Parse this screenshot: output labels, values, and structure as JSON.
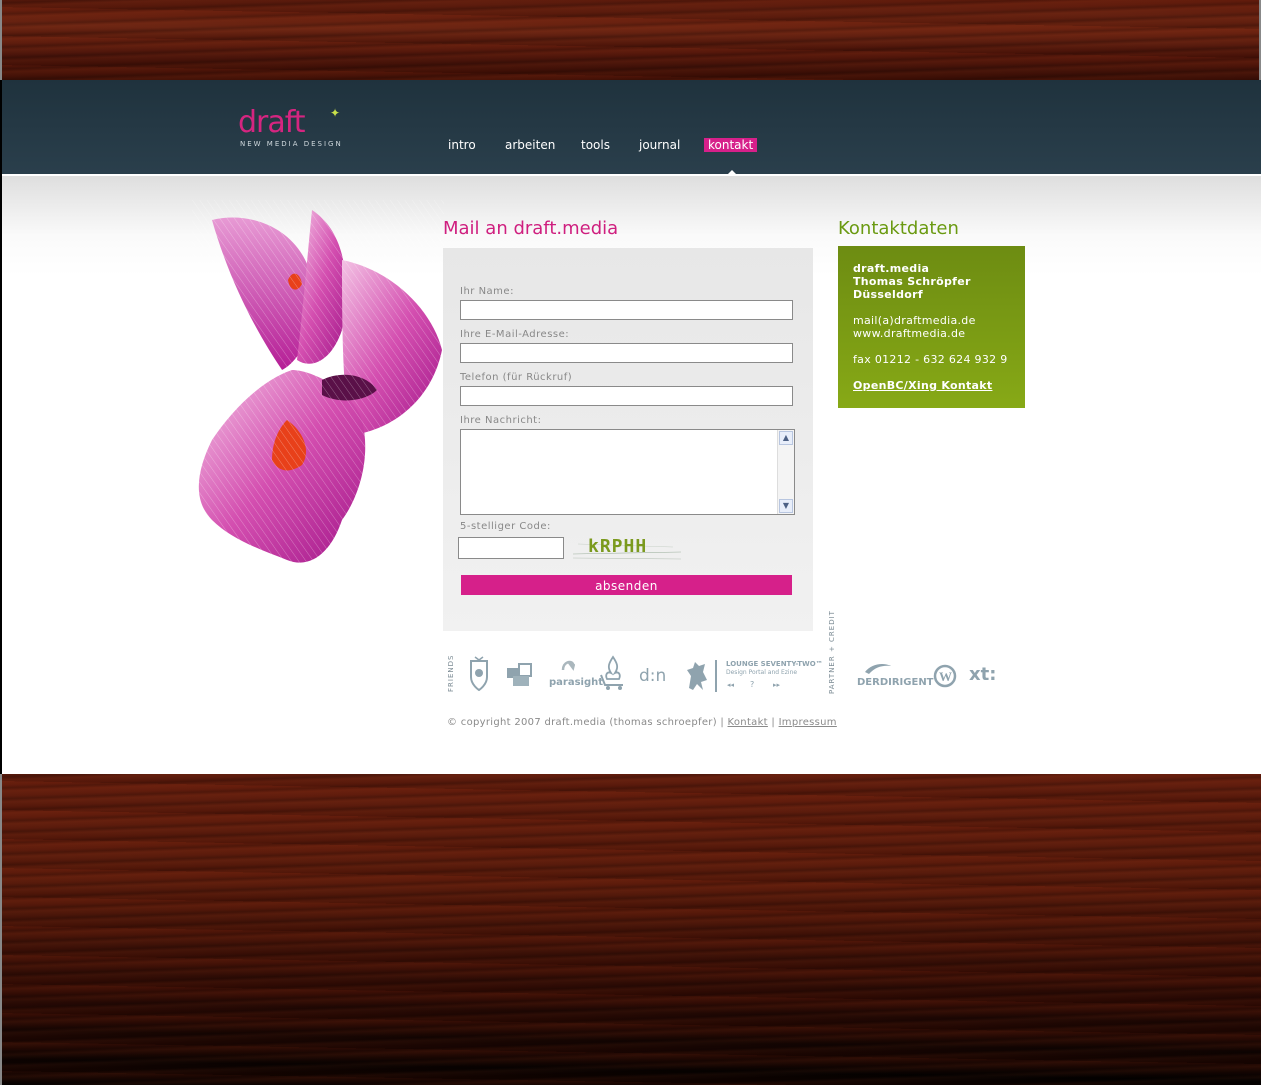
{
  "brand": {
    "logo_word": "draft",
    "logo_tagline": "new media design"
  },
  "nav": {
    "items": [
      {
        "label": "intro"
      },
      {
        "label": "arbeiten"
      },
      {
        "label": "tools"
      },
      {
        "label": "journal"
      },
      {
        "label": "kontakt",
        "active": true
      }
    ]
  },
  "mail": {
    "title": "Mail an draft.media",
    "name_label": "Ihr Name:",
    "name_value": "",
    "email_label": "Ihre E-Mail-Adresse:",
    "email_value": "",
    "phone_label": "Telefon (für Rückruf)",
    "phone_value": "",
    "message_label": "Ihre Nachricht:",
    "message_value": "",
    "code_label": "5-stelliger Code:",
    "code_value": "",
    "captcha_text": "kRPHH",
    "submit_label": "absenden"
  },
  "kontakt": {
    "title": "Kontaktdaten",
    "company": "draft.media",
    "person": "Thomas Schröpfer",
    "city": "Düsseldorf",
    "email": "mail(a)draftmedia.de",
    "web": "www.draftmedia.de",
    "fax": "fax 01212 - 632 624 932 9",
    "link_label": "OpenBC/Xing Kontakt"
  },
  "friends": {
    "label": "friends",
    "parasight": "parasight",
    "dn": "d:n",
    "lounge_title": "LOUNGE SEVENTY-TWO™",
    "lounge_subtitle": "Design Portal and Ezine",
    "lounge_controls": [
      "◂◂",
      "?",
      "▸▸"
    ]
  },
  "partners": {
    "label": "partner + credit",
    "derdirigent": "DERDIRIGENT",
    "xt": "xt:"
  },
  "footer": {
    "copyright": "© copyright 2007 draft.media (thomas schroepfer) |",
    "separator": "|",
    "kontakt_link": "Kontakt",
    "impressum_link": "Impressum"
  },
  "colors": {
    "accent_pink": "#d6208a",
    "accent_green": "#7a9b14",
    "header_bg": "#253944"
  }
}
